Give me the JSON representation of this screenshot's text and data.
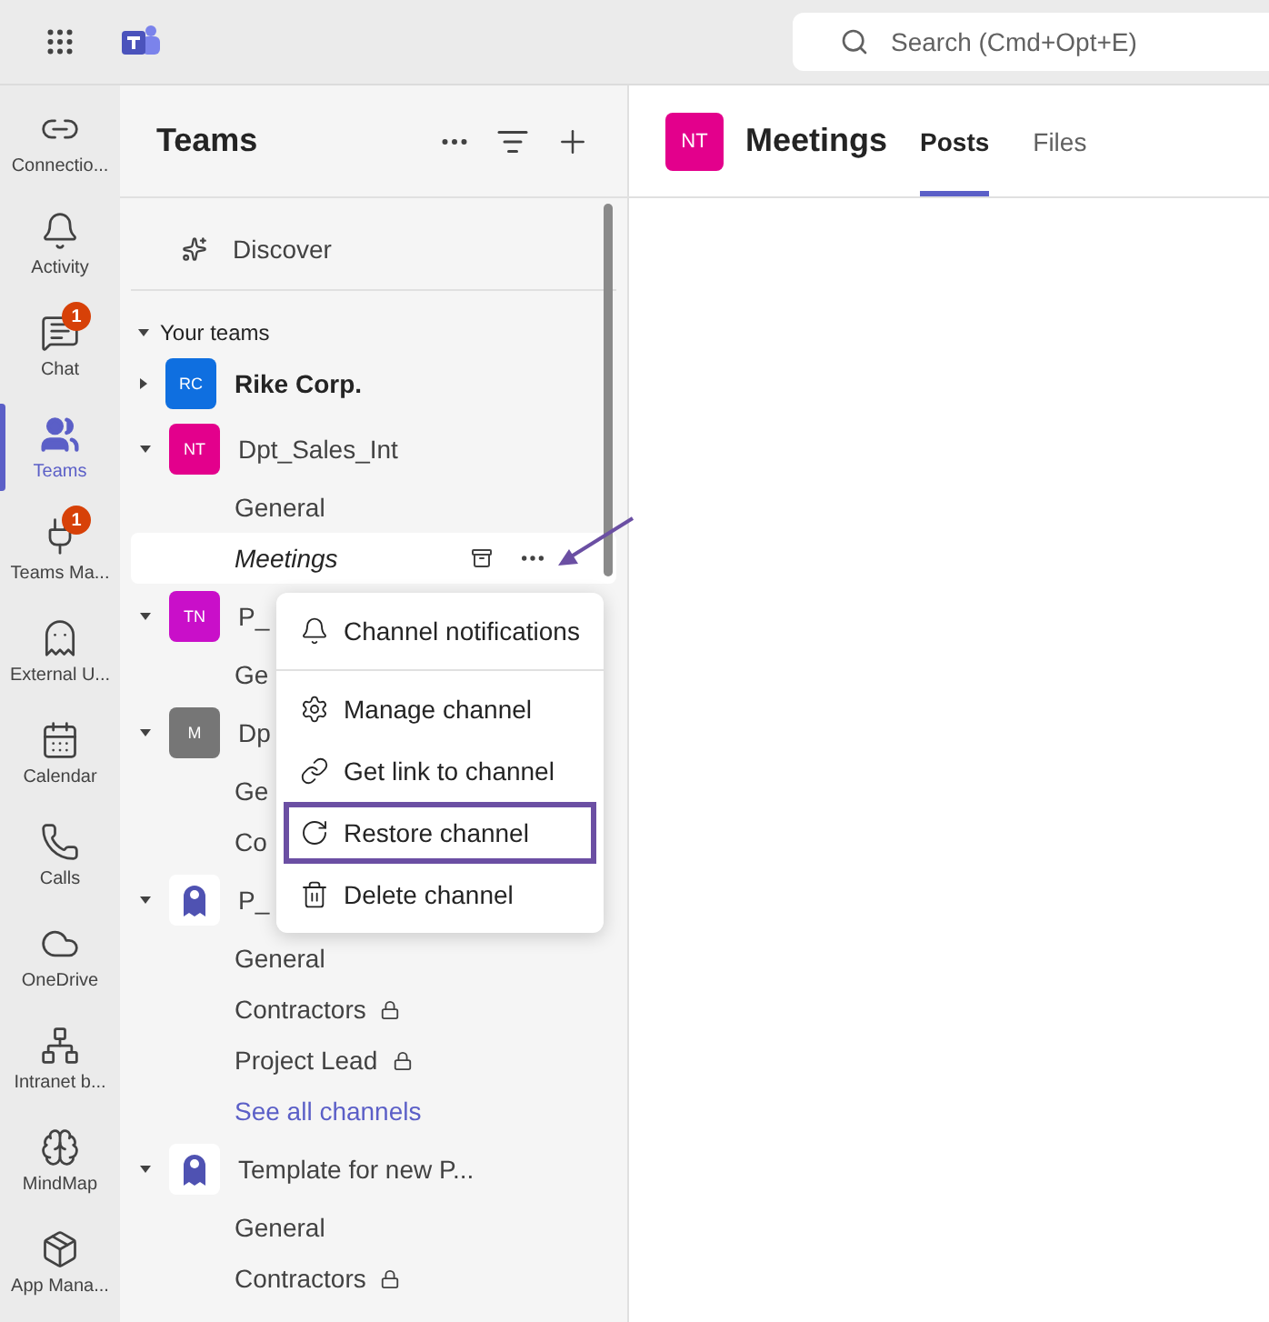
{
  "top_bar": {
    "search": {
      "placeholder": "Search (Cmd+Opt+E)"
    }
  },
  "rail": [
    {
      "label": "Connectio...",
      "selected": false
    },
    {
      "label": "Activity",
      "selected": false
    },
    {
      "label": "Chat",
      "selected": false,
      "badge": "1"
    },
    {
      "label": "Teams",
      "selected": true
    },
    {
      "label": "Teams Ma...",
      "selected": false,
      "badge": "1"
    },
    {
      "label": "External U...",
      "selected": false
    },
    {
      "label": "Calendar",
      "selected": false
    },
    {
      "label": "Calls",
      "selected": false
    },
    {
      "label": "OneDrive",
      "selected": false
    },
    {
      "label": "Intranet b...",
      "selected": false
    },
    {
      "label": "MindMap",
      "selected": false
    },
    {
      "label": "App Mana...",
      "selected": false
    }
  ],
  "teams_panel": {
    "title": "Teams",
    "discover": "Discover",
    "section": "Your teams",
    "teams": [
      {
        "kind": "initials",
        "initials": "RC",
        "color": "#0f6fe0",
        "name": "Rike Corp.",
        "unread": true,
        "expanded": false
      },
      {
        "kind": "initials",
        "initials": "NT",
        "color": "#e3008c",
        "name": "Dpt_Sales_Int",
        "unread": false,
        "expanded": true,
        "channels": [
          {
            "name": "General",
            "private": false,
            "archived": false,
            "selected": false
          },
          {
            "name": "Meetings",
            "private": false,
            "archived": true,
            "selected": true
          }
        ]
      },
      {
        "kind": "initials",
        "initials": "TN",
        "color": "#c90fc9",
        "name": "P_",
        "unread": false,
        "expanded": true,
        "channels": [
          {
            "name": "Ge"
          }
        ]
      },
      {
        "kind": "initials",
        "initials": "M",
        "color": "#767676",
        "name": "Dp",
        "unread": false,
        "expanded": true,
        "channels": [
          {
            "name": "Ge"
          },
          {
            "name": "Co"
          }
        ]
      },
      {
        "kind": "logo",
        "name": "P_",
        "unread": false,
        "expanded": true,
        "channels": [
          {
            "name": "General",
            "private": false,
            "archived": false,
            "selected": false
          },
          {
            "name": "Contractors",
            "private": true,
            "archived": false,
            "selected": false
          },
          {
            "name": "Project Lead",
            "private": true,
            "archived": false,
            "selected": false
          }
        ],
        "see_all": "See all channels"
      },
      {
        "kind": "logo",
        "name": "Template for new P...",
        "unread": false,
        "expanded": true,
        "channels": [
          {
            "name": "General",
            "private": false,
            "archived": false,
            "selected": false
          },
          {
            "name": "Contractors",
            "private": true,
            "archived": false,
            "selected": false
          }
        ]
      }
    ]
  },
  "menu": {
    "items": [
      {
        "kind": "notifications",
        "label": "Channel notifications",
        "highlighted": false
      },
      {
        "kind": "manage",
        "label": "Manage channel",
        "highlighted": false
      },
      {
        "kind": "link",
        "label": "Get link to channel",
        "highlighted": false
      },
      {
        "kind": "restore",
        "label": "Restore channel",
        "highlighted": true
      },
      {
        "kind": "delete",
        "label": "Delete channel",
        "highlighted": false
      }
    ]
  },
  "main": {
    "initials": "NT",
    "color": "#e3008c",
    "title": "Meetings",
    "tabs": [
      {
        "label": "Posts",
        "selected": true
      },
      {
        "label": "Files",
        "selected": false
      }
    ]
  }
}
